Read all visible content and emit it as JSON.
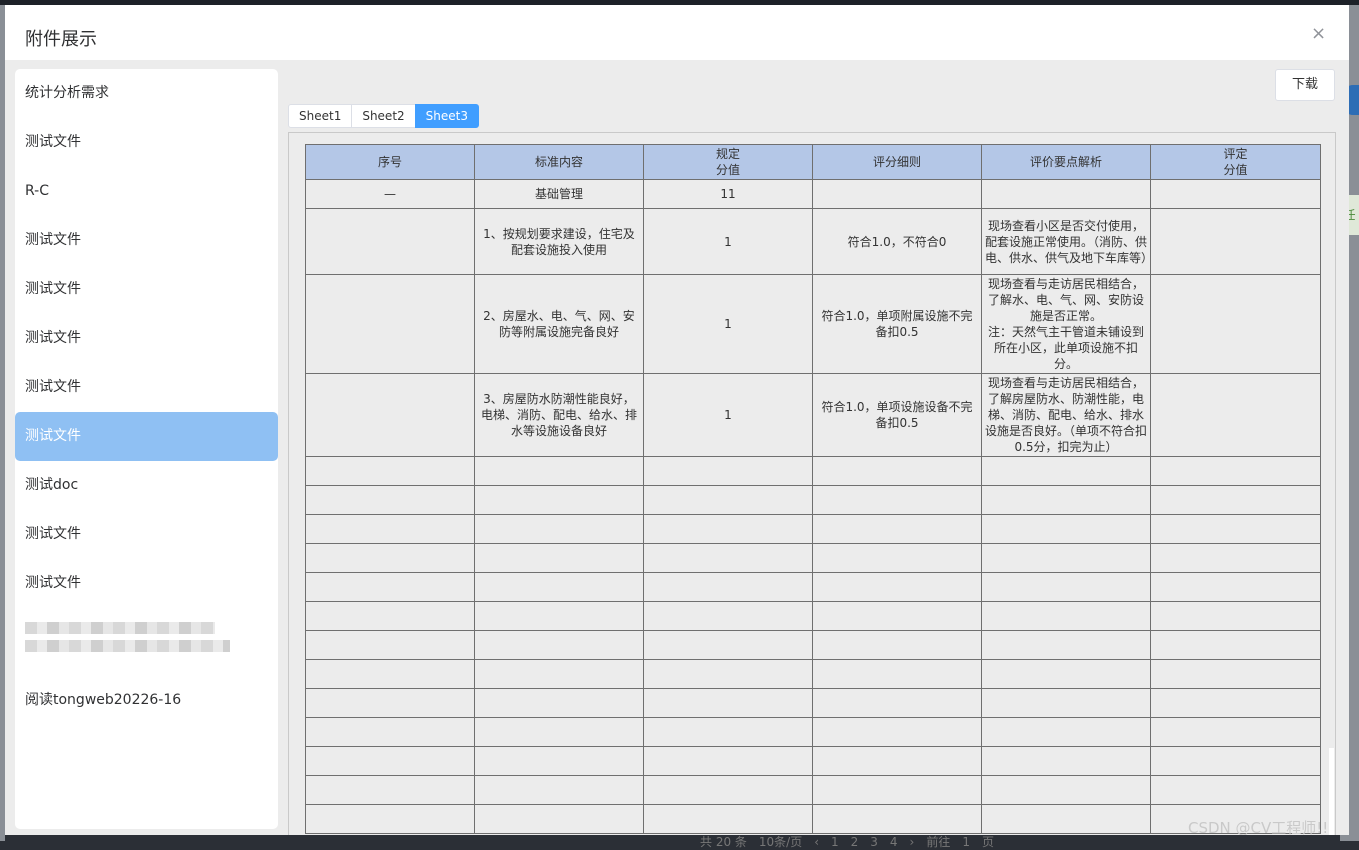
{
  "dialog": {
    "title": "附件展示",
    "close_glyph": "×",
    "download_label": "下载"
  },
  "sidebar": {
    "items": [
      {
        "label": "统计分析需求"
      },
      {
        "label": "测试文件"
      },
      {
        "label": "R-C"
      },
      {
        "label": "测试文件"
      },
      {
        "label": "测试文件"
      },
      {
        "label": "测试文件"
      },
      {
        "label": "测试文件"
      },
      {
        "label": "测试文件",
        "active": true
      },
      {
        "label": "测试doc"
      },
      {
        "label": "测试文件"
      },
      {
        "label": "测试文件"
      },
      {
        "label": "阅读tongweb20226-16"
      }
    ]
  },
  "sheet_tabs": [
    {
      "label": "Sheet1"
    },
    {
      "label": "Sheet2"
    },
    {
      "label": "Sheet3",
      "active": true
    }
  ],
  "table": {
    "headers": [
      "序号",
      "标准内容",
      "规定\n分值",
      "评分细则",
      "评价要点解析",
      "评定\n分值"
    ],
    "rows": [
      [
        "—",
        "基础管理",
        "11",
        "",
        "",
        ""
      ],
      [
        "",
        "1、按规划要求建设，住宅及配套设施投入使用",
        "1",
        "符合1.0，不符合0",
        "现场查看小区是否交付使用，配套设施正常使用。（消防、供电、供水、供气及地下车库等）",
        ""
      ],
      [
        "",
        "2、房屋水、电、气、网、安防等附属设施完备良好",
        "1",
        "符合1.0，单项附属设施不完备扣0.5",
        "现场查看与走访居民相结合，了解水、电、气、网、安防设施是否正常。\n注：天然气主干管道未铺设到所在小区，此单项设施不扣分。",
        ""
      ],
      [
        "",
        "3、房屋防水防潮性能良好，电梯、消防、配电、给水、排水等设施设备良好",
        "1",
        "符合1.0，单项设施设备不完备扣0.5",
        "现场查看与走访居民相结合，了解房屋防水、防潮性能，电梯、消防、配电、给水、排水设施是否良好。（单项不符合扣0.5分，扣完为止）",
        ""
      ]
    ],
    "empty_rows": 13
  },
  "watermark": "CSDN @CV工程师!!",
  "background_peek": {
    "pagination_text": "共 20 条　10条/页　‹　1　2　3　4　›　前往　1　页",
    "side_badge": "任"
  }
}
